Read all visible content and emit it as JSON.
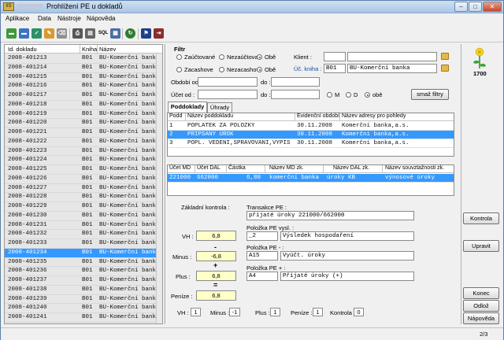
{
  "window": {
    "title": "Prohlížení PE u dokladů",
    "app_icon": "IIS",
    "buttons": [
      "–",
      "□",
      "✕"
    ]
  },
  "menu": [
    "Aplikace",
    "Data",
    "Nástroje",
    "Nápověda"
  ],
  "toolbar_icons": [
    "folder-green-icon",
    "folder-blue-icon",
    "folder-check-icon",
    "pencil-icon",
    "eraser-icon",
    "print-icon",
    "print-preview-icon",
    "sql-icon",
    "table-icon",
    "refresh-icon",
    "flag-icon",
    "exit-icon"
  ],
  "toolbar_sql_label": "SQL",
  "left_list": {
    "columns": [
      "Id. dokladu",
      "Kniha",
      "Název"
    ],
    "rows": [
      [
        "2008-401213",
        "B01",
        "BU-Komerční bank"
      ],
      [
        "2008-401214",
        "B01",
        "BU-Komerční bank"
      ],
      [
        "2008-401215",
        "B01",
        "BU-Komerční bank"
      ],
      [
        "2008-401216",
        "B01",
        "BU-Komerční bank"
      ],
      [
        "2008-401217",
        "B01",
        "BU-Komerční bank"
      ],
      [
        "2008-401218",
        "B01",
        "BU-Komerční bank"
      ],
      [
        "2008-401219",
        "B01",
        "BU-Komerční bank"
      ],
      [
        "2008-401220",
        "B01",
        "BU-Komerční bank"
      ],
      [
        "2008-401221",
        "B01",
        "BU-Komerční bank"
      ],
      [
        "2008-401222",
        "B01",
        "BU-Komerční bank"
      ],
      [
        "2008-401223",
        "B01",
        "BU-Komerční bank"
      ],
      [
        "2008-401224",
        "B01",
        "BU-Komerční bank"
      ],
      [
        "2008-401225",
        "B01",
        "BU-Komerční bank"
      ],
      [
        "2008-401226",
        "B01",
        "BU-Komerční bank"
      ],
      [
        "2008-401227",
        "B01",
        "BU-Komerční bank"
      ],
      [
        "2008-401228",
        "B01",
        "BU-Komerční bank"
      ],
      [
        "2008-401229",
        "B01",
        "BU-Komerční bank"
      ],
      [
        "2008-401230",
        "B01",
        "BU-Komerční bank"
      ],
      [
        "2008-401231",
        "B01",
        "BU-Komerční bank"
      ],
      [
        "2008-401232",
        "B01",
        "BU-Komerční bank"
      ],
      [
        "2008-401233",
        "B01",
        "BU-Komerční bank"
      ],
      [
        "2008-401234",
        "B01",
        "BU-Komerční bank"
      ],
      [
        "2008-401235",
        "B01",
        "BU-Komerční bank"
      ],
      [
        "2008-401236",
        "B01",
        "BU-Komerční bank"
      ],
      [
        "2008-401237",
        "B01",
        "BU-Komerční bank"
      ],
      [
        "2008-401238",
        "B01",
        "BU-Komerční bank"
      ],
      [
        "2008-401239",
        "B01",
        "BU-Komerční bank"
      ],
      [
        "2008-401240",
        "B01",
        "BU-Komerční bank"
      ],
      [
        "2008-401241",
        "B01",
        "BU-Komerční bank"
      ]
    ],
    "selected_index": 21
  },
  "filter": {
    "title": "Filtr",
    "radio_group1": [
      "Zaúčtované",
      "Nezaúčtova",
      "Obě"
    ],
    "radio_group1_selected": 2,
    "radio_group2": [
      "Zacashove",
      "Nezacashov",
      "Obě"
    ],
    "radio_group2_selected": 2,
    "klient_label": "Klient :",
    "klient_code": "",
    "klient_name": "",
    "uc_kniha_label": "Úč. kniha :",
    "uc_kniha_code": "B01",
    "uc_kniha_name": "BU-Komerční banka",
    "obdobi_od_label": "Období od :",
    "obdobi_od": "",
    "obdobi_do_label": "do :",
    "obdobi_do": "",
    "ucet_od_label": "Účet od :",
    "ucet_od": "",
    "ucet_do_label": "do :",
    "ucet_do": "",
    "radio_group3": [
      "M",
      "D",
      "obě"
    ],
    "radio_group3_selected": 2,
    "clear_button": "smaž filtry"
  },
  "tabs": [
    "Poddoklady",
    "Úhrady"
  ],
  "poddoklady": {
    "columns": [
      "Podd",
      "Název poddokladu",
      "Evidenční období",
      "Název adresy pro pohledy"
    ],
    "rows": [
      [
        "1",
        "POPLATEK ZA POLOZKY",
        "30.11.2008",
        "Komerční banka,a.s."
      ],
      [
        "2",
        "PRIPSANY UROK",
        "30.11.2008",
        "Komerční banka,a.s."
      ],
      [
        "3",
        "POPL. VEDENI,SPRAVOVANI,VYPIS",
        "30.11.2008",
        "Komerční banka,a.s."
      ]
    ],
    "selected_index": 1
  },
  "ucty": {
    "columns": [
      "Účet MD",
      "Účet DAL",
      "Částka",
      "Název MD zk.",
      "Název DAL zk.",
      "Název souvztažnosti zk."
    ],
    "rows": [
      [
        "221000",
        "662000",
        "6,80",
        "komerční banka",
        "úroky KB",
        "výnosové úroky"
      ]
    ],
    "selected_index": 0
  },
  "kontrola": {
    "title": "Základní kontrola :",
    "vh_label": "VH :",
    "vh": "6,8",
    "minus_label": "Minus :",
    "minus_sign": "-",
    "minus": "-6,8",
    "plus_label": "Plus :",
    "plus_sign": "+",
    "plus": "6,8",
    "penize_label": "Peníze :",
    "eq_sign": "=",
    "penize": "6,8"
  },
  "detail": {
    "transakce_label": "Transakce PE :",
    "transakce": "přijaté úroky 221000/662000",
    "polozka_vysl_label": "Položka PE vysl. :",
    "polozka_vysl_code": "_2",
    "polozka_vysl_name": "Výsledek hospodaření",
    "polozka_minus_label": "Položka PE - :",
    "polozka_minus_code": "A15",
    "polozka_minus_name": "Vyúčt. úroky",
    "polozka_plus_label": "Položka PE + :",
    "polozka_plus_code": "A4",
    "polozka_plus_name": "Přijaté úroky (+)"
  },
  "summary": {
    "vh_label": "VH :",
    "vh": "1",
    "minus_label": "Minus :",
    "minus": "-1",
    "plus_label": "Plus :",
    "plus": "1",
    "penize_label": "Peníze :",
    "penize": "1",
    "kontrola_label": "Kontrola :",
    "kontrola": "0"
  },
  "right_panel": {
    "year": "1700",
    "logo_icon": "flower-icon",
    "buttons": [
      "Kontrola",
      "Upravit",
      "Konec",
      "Odlož",
      "Nápověda"
    ]
  },
  "status": {
    "page": "2/3"
  },
  "colors": {
    "selection": "#3399ff",
    "yellow_field": "#ffffc8",
    "title_bar": "#b9d1ea"
  }
}
